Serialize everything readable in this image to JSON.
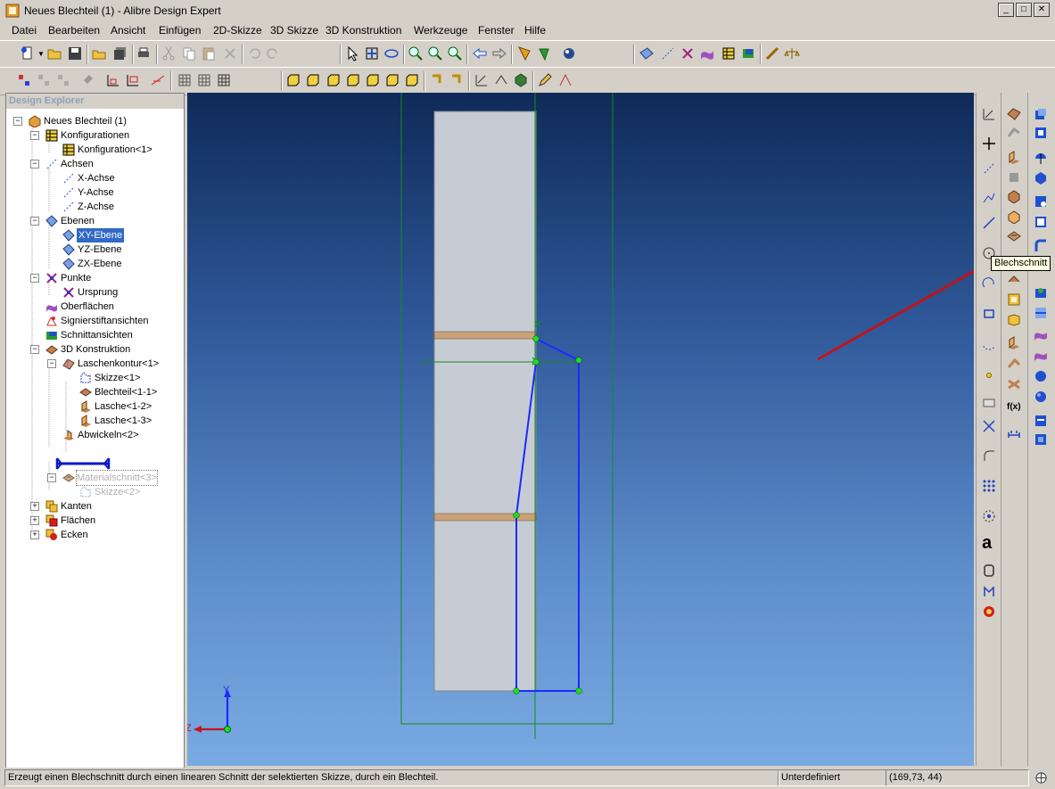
{
  "window": {
    "title": "Neues Blechteil (1) - Alibre Design Expert",
    "minimize": "_",
    "maximize": "□",
    "close": "✕"
  },
  "menu": [
    "Datei",
    "Bearbeiten",
    "Ansicht",
    "Einfügen",
    "2D-Skizze",
    "3D Skizze",
    "3D Konstruktion",
    "Werkzeuge",
    "Fenster",
    "Hilfe"
  ],
  "explorer": {
    "title": "Design Explorer",
    "nodes": [
      {
        "label": "Neues Blechteil (1)",
        "icon": "part-icon"
      },
      {
        "label": "Konfigurationen",
        "icon": "configurations-icon"
      },
      {
        "label": "Konfiguration<1>",
        "icon": "configuration-icon"
      },
      {
        "label": "Achsen",
        "icon": "axes-icon"
      },
      {
        "label": "X-Achse",
        "icon": "axis-icon"
      },
      {
        "label": "Y-Achse",
        "icon": "axis-icon"
      },
      {
        "label": "Z-Achse",
        "icon": "axis-icon"
      },
      {
        "label": "Ebenen",
        "icon": "planes-icon"
      },
      {
        "label": "XY-Ebene",
        "icon": "plane-icon"
      },
      {
        "label": "YZ-Ebene",
        "icon": "plane-icon"
      },
      {
        "label": "ZX-Ebene",
        "icon": "plane-icon"
      },
      {
        "label": "Punkte",
        "icon": "points-icon"
      },
      {
        "label": "Ursprung",
        "icon": "origin-icon"
      },
      {
        "label": "Oberflächen",
        "icon": "surfaces-icon"
      },
      {
        "label": "Signierstiftansichten",
        "icon": "markup-icon"
      },
      {
        "label": "Schnittansichten",
        "icon": "section-view-icon"
      },
      {
        "label": "3D Konstruktion",
        "icon": "design-icon"
      },
      {
        "label": "Laschenkontur<1>",
        "icon": "contour-flange-icon"
      },
      {
        "label": "Skizze<1>",
        "icon": "sketch-icon"
      },
      {
        "label": "Blechteil<1-1>",
        "icon": "sheet-icon"
      },
      {
        "label": "Lasche<1-2>",
        "icon": "flange-icon"
      },
      {
        "label": "Lasche<1-3>",
        "icon": "flange-icon"
      },
      {
        "label": "Abwickeln<2>",
        "icon": "unfold-icon"
      },
      {
        "label": "Materialschnitt<3>",
        "icon": "cut-icon"
      },
      {
        "label": "Skizze<2>",
        "icon": "sketch-icon"
      },
      {
        "label": "Kanten",
        "icon": "edges-icon"
      },
      {
        "label": "Flächen",
        "icon": "faces-icon"
      },
      {
        "label": "Ecken",
        "icon": "corners-icon"
      }
    ]
  },
  "tooltip": "Blechschnitt",
  "axes": {
    "y": "Y",
    "z": "Z"
  },
  "status": {
    "message": "Erzeugt einen Blechschnitt durch einen linearen Schnitt der selektierten Skizze, durch ein Blechteil.",
    "state": "Unterdefiniert",
    "coords": "(169,73, 44)"
  },
  "colors": {
    "sketch": "#1a2bff",
    "bend": "#c9a27a",
    "sketch_plane": "#1a8a1a",
    "annotation_arrow": "#c0141c",
    "highlight": "#316ac5"
  }
}
